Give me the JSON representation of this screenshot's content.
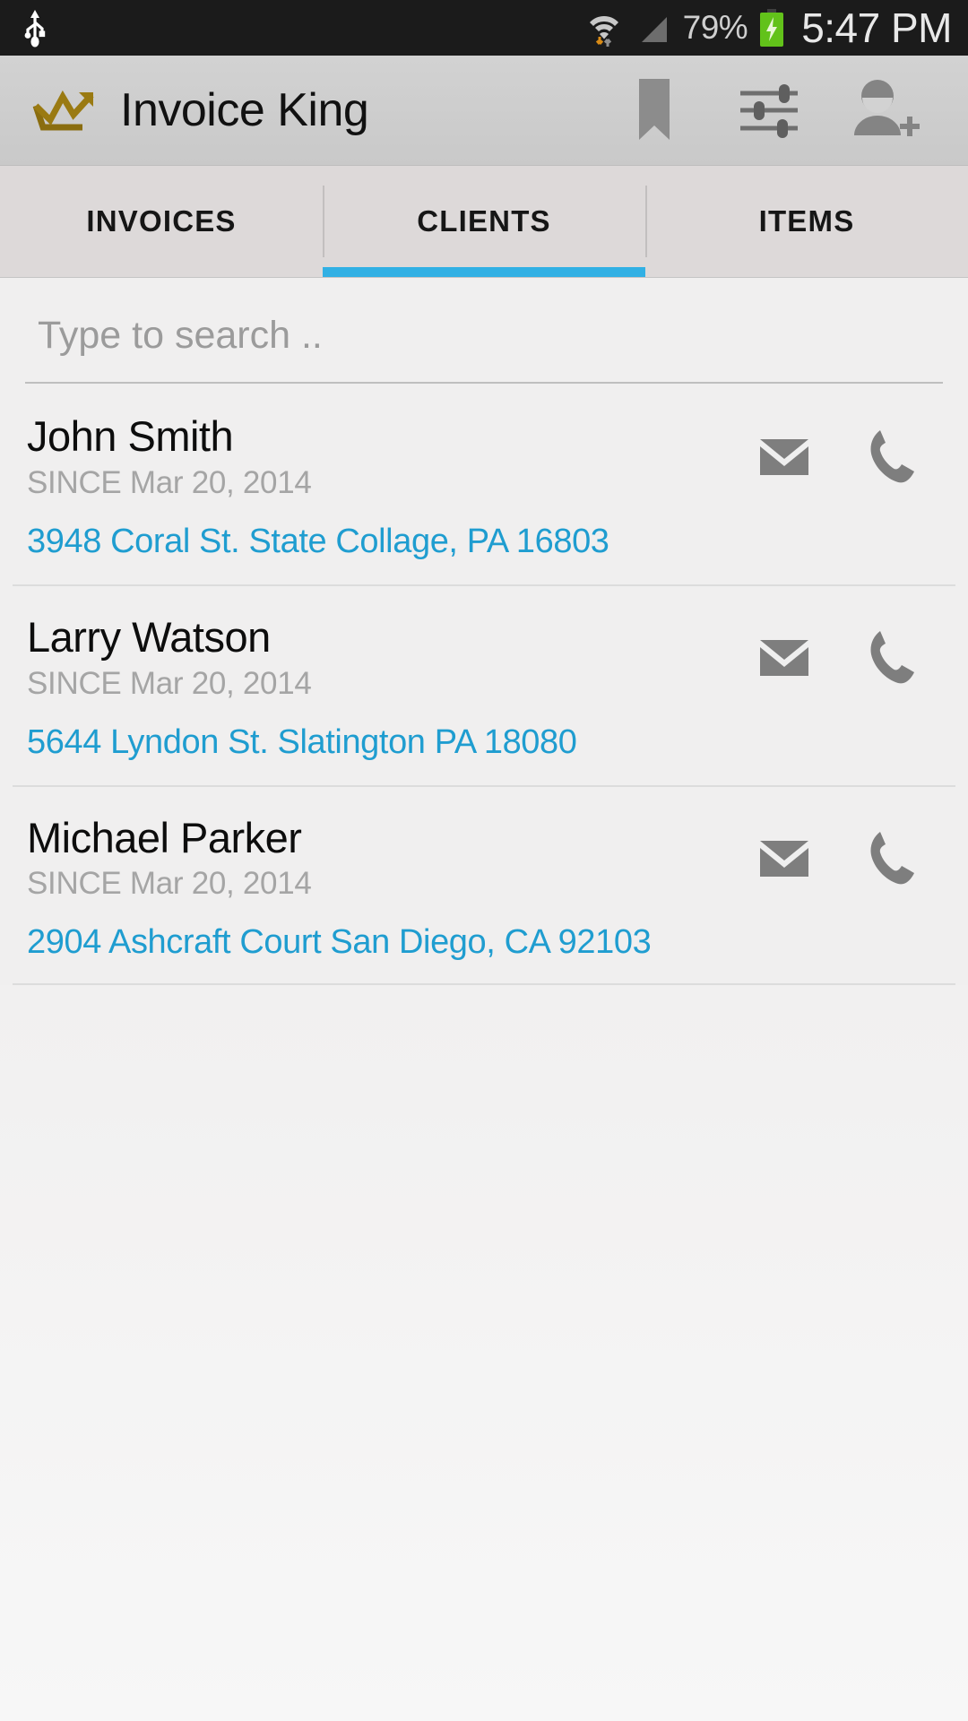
{
  "status_bar": {
    "usb_icon": "usb-icon",
    "wifi_icon": "wifi-icon",
    "signal_icon": "signal-icon",
    "battery_percent": "79%",
    "battery_icon": "battery-charging-icon",
    "time": "5:47 PM"
  },
  "action_bar": {
    "logo_icon": "crown-trending-logo",
    "title": "Invoice King",
    "actions": [
      {
        "name": "bookmark-icon",
        "label": "Bookmark"
      },
      {
        "name": "settings-sliders-icon",
        "label": "Settings"
      },
      {
        "name": "add-person-icon",
        "label": "Add Client"
      }
    ]
  },
  "tabs": {
    "items": [
      {
        "label": "INVOICES",
        "active": false
      },
      {
        "label": "CLIENTS",
        "active": true
      },
      {
        "label": "ITEMS",
        "active": false
      }
    ],
    "active_index": 1,
    "indicator_color": "#31b0e4"
  },
  "search": {
    "placeholder": "Type to search ..",
    "value": ""
  },
  "clients": [
    {
      "name": "John Smith",
      "since": "SINCE Mar 20, 2014",
      "address": "3948 Coral St. State Collage, PA 16803",
      "email_icon": "email-icon",
      "phone_icon": "phone-icon"
    },
    {
      "name": "Larry Watson",
      "since": "SINCE Mar 20, 2014",
      "address": "5644 Lyndon St. Slatington PA 18080",
      "email_icon": "email-icon",
      "phone_icon": "phone-icon"
    },
    {
      "name": "Michael Parker",
      "since": "SINCE Mar 20, 2014",
      "address": "2904 Ashcraft Court San Diego, CA 92103",
      "email_icon": "email-icon",
      "phone_icon": "phone-icon"
    }
  ],
  "colors": {
    "accent_blue": "#31b0e4",
    "address_link": "#1f9dd0",
    "logo_gold": "#9a7a12",
    "status_bar_bg": "#1b1b1b",
    "action_bar_bg": "#cfcfcf",
    "tab_bar_bg": "#ddd9d9",
    "page_bg": "#f0efef",
    "battery_green": "#62c21a"
  }
}
